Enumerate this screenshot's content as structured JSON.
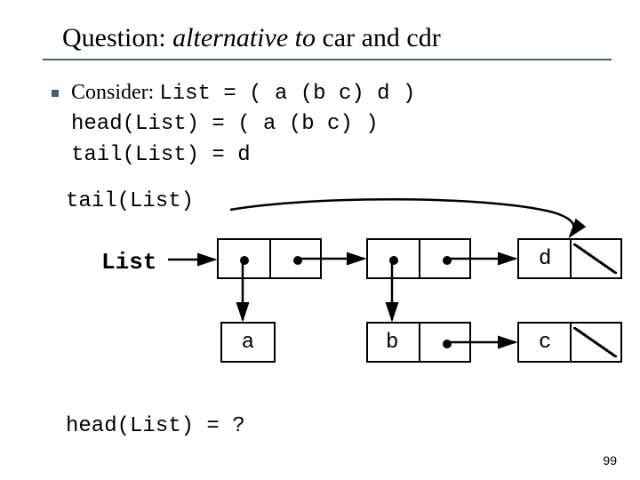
{
  "title": {
    "q": "Question: ",
    "alt": "alternative to",
    "rest": " car and cdr"
  },
  "intro": {
    "consider": "Consider: ",
    "line1": "List = ( a (b c) d )",
    "line2": "head(List) = ( a (b c) )",
    "line3": "tail(List) = d"
  },
  "labels": {
    "tail": "tail(List)",
    "head": "head(List) = ?",
    "list": "List"
  },
  "atoms": {
    "a": "a",
    "b": "b",
    "c": "c",
    "d": "d"
  },
  "page": "99"
}
